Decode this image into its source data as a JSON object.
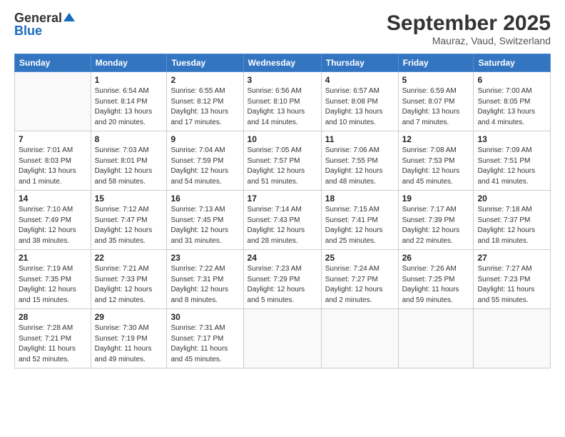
{
  "logo": {
    "general": "General",
    "blue": "Blue"
  },
  "title": "September 2025",
  "location": "Mauraz, Vaud, Switzerland",
  "header_days": [
    "Sunday",
    "Monday",
    "Tuesday",
    "Wednesday",
    "Thursday",
    "Friday",
    "Saturday"
  ],
  "weeks": [
    [
      {
        "day": "",
        "sunrise": "",
        "sunset": "",
        "daylight": ""
      },
      {
        "day": "1",
        "sunrise": "Sunrise: 6:54 AM",
        "sunset": "Sunset: 8:14 PM",
        "daylight": "Daylight: 13 hours and 20 minutes."
      },
      {
        "day": "2",
        "sunrise": "Sunrise: 6:55 AM",
        "sunset": "Sunset: 8:12 PM",
        "daylight": "Daylight: 13 hours and 17 minutes."
      },
      {
        "day": "3",
        "sunrise": "Sunrise: 6:56 AM",
        "sunset": "Sunset: 8:10 PM",
        "daylight": "Daylight: 13 hours and 14 minutes."
      },
      {
        "day": "4",
        "sunrise": "Sunrise: 6:57 AM",
        "sunset": "Sunset: 8:08 PM",
        "daylight": "Daylight: 13 hours and 10 minutes."
      },
      {
        "day": "5",
        "sunrise": "Sunrise: 6:59 AM",
        "sunset": "Sunset: 8:07 PM",
        "daylight": "Daylight: 13 hours and 7 minutes."
      },
      {
        "day": "6",
        "sunrise": "Sunrise: 7:00 AM",
        "sunset": "Sunset: 8:05 PM",
        "daylight": "Daylight: 13 hours and 4 minutes."
      }
    ],
    [
      {
        "day": "7",
        "sunrise": "Sunrise: 7:01 AM",
        "sunset": "Sunset: 8:03 PM",
        "daylight": "Daylight: 13 hours and 1 minute."
      },
      {
        "day": "8",
        "sunrise": "Sunrise: 7:03 AM",
        "sunset": "Sunset: 8:01 PM",
        "daylight": "Daylight: 12 hours and 58 minutes."
      },
      {
        "day": "9",
        "sunrise": "Sunrise: 7:04 AM",
        "sunset": "Sunset: 7:59 PM",
        "daylight": "Daylight: 12 hours and 54 minutes."
      },
      {
        "day": "10",
        "sunrise": "Sunrise: 7:05 AM",
        "sunset": "Sunset: 7:57 PM",
        "daylight": "Daylight: 12 hours and 51 minutes."
      },
      {
        "day": "11",
        "sunrise": "Sunrise: 7:06 AM",
        "sunset": "Sunset: 7:55 PM",
        "daylight": "Daylight: 12 hours and 48 minutes."
      },
      {
        "day": "12",
        "sunrise": "Sunrise: 7:08 AM",
        "sunset": "Sunset: 7:53 PM",
        "daylight": "Daylight: 12 hours and 45 minutes."
      },
      {
        "day": "13",
        "sunrise": "Sunrise: 7:09 AM",
        "sunset": "Sunset: 7:51 PM",
        "daylight": "Daylight: 12 hours and 41 minutes."
      }
    ],
    [
      {
        "day": "14",
        "sunrise": "Sunrise: 7:10 AM",
        "sunset": "Sunset: 7:49 PM",
        "daylight": "Daylight: 12 hours and 38 minutes."
      },
      {
        "day": "15",
        "sunrise": "Sunrise: 7:12 AM",
        "sunset": "Sunset: 7:47 PM",
        "daylight": "Daylight: 12 hours and 35 minutes."
      },
      {
        "day": "16",
        "sunrise": "Sunrise: 7:13 AM",
        "sunset": "Sunset: 7:45 PM",
        "daylight": "Daylight: 12 hours and 31 minutes."
      },
      {
        "day": "17",
        "sunrise": "Sunrise: 7:14 AM",
        "sunset": "Sunset: 7:43 PM",
        "daylight": "Daylight: 12 hours and 28 minutes."
      },
      {
        "day": "18",
        "sunrise": "Sunrise: 7:15 AM",
        "sunset": "Sunset: 7:41 PM",
        "daylight": "Daylight: 12 hours and 25 minutes."
      },
      {
        "day": "19",
        "sunrise": "Sunrise: 7:17 AM",
        "sunset": "Sunset: 7:39 PM",
        "daylight": "Daylight: 12 hours and 22 minutes."
      },
      {
        "day": "20",
        "sunrise": "Sunrise: 7:18 AM",
        "sunset": "Sunset: 7:37 PM",
        "daylight": "Daylight: 12 hours and 18 minutes."
      }
    ],
    [
      {
        "day": "21",
        "sunrise": "Sunrise: 7:19 AM",
        "sunset": "Sunset: 7:35 PM",
        "daylight": "Daylight: 12 hours and 15 minutes."
      },
      {
        "day": "22",
        "sunrise": "Sunrise: 7:21 AM",
        "sunset": "Sunset: 7:33 PM",
        "daylight": "Daylight: 12 hours and 12 minutes."
      },
      {
        "day": "23",
        "sunrise": "Sunrise: 7:22 AM",
        "sunset": "Sunset: 7:31 PM",
        "daylight": "Daylight: 12 hours and 8 minutes."
      },
      {
        "day": "24",
        "sunrise": "Sunrise: 7:23 AM",
        "sunset": "Sunset: 7:29 PM",
        "daylight": "Daylight: 12 hours and 5 minutes."
      },
      {
        "day": "25",
        "sunrise": "Sunrise: 7:24 AM",
        "sunset": "Sunset: 7:27 PM",
        "daylight": "Daylight: 12 hours and 2 minutes."
      },
      {
        "day": "26",
        "sunrise": "Sunrise: 7:26 AM",
        "sunset": "Sunset: 7:25 PM",
        "daylight": "Daylight: 11 hours and 59 minutes."
      },
      {
        "day": "27",
        "sunrise": "Sunrise: 7:27 AM",
        "sunset": "Sunset: 7:23 PM",
        "daylight": "Daylight: 11 hours and 55 minutes."
      }
    ],
    [
      {
        "day": "28",
        "sunrise": "Sunrise: 7:28 AM",
        "sunset": "Sunset: 7:21 PM",
        "daylight": "Daylight: 11 hours and 52 minutes."
      },
      {
        "day": "29",
        "sunrise": "Sunrise: 7:30 AM",
        "sunset": "Sunset: 7:19 PM",
        "daylight": "Daylight: 11 hours and 49 minutes."
      },
      {
        "day": "30",
        "sunrise": "Sunrise: 7:31 AM",
        "sunset": "Sunset: 7:17 PM",
        "daylight": "Daylight: 11 hours and 45 minutes."
      },
      {
        "day": "",
        "sunrise": "",
        "sunset": "",
        "daylight": ""
      },
      {
        "day": "",
        "sunrise": "",
        "sunset": "",
        "daylight": ""
      },
      {
        "day": "",
        "sunrise": "",
        "sunset": "",
        "daylight": ""
      },
      {
        "day": "",
        "sunrise": "",
        "sunset": "",
        "daylight": ""
      }
    ]
  ]
}
